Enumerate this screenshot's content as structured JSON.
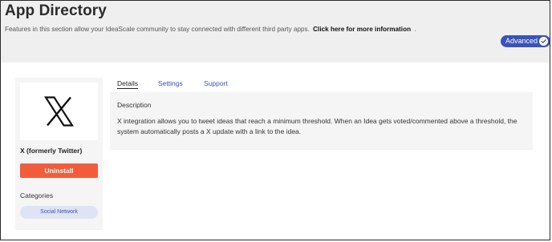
{
  "header": {
    "title": "App Directory",
    "intro_text": "Features in this section allow your IdeaScale community to stay connected with different third party apps.",
    "intro_link": "Click here for more information",
    "intro_suffix": ".",
    "advanced_label": "Advanced"
  },
  "app": {
    "name": "X (formerly Twitter)",
    "uninstall_label": "Uninstall",
    "categories_heading": "Categories",
    "categories": [
      "Social Network"
    ],
    "logo_icon": "x-logo-icon"
  },
  "tabs": [
    {
      "label": "Details",
      "active": true
    },
    {
      "label": "Settings",
      "active": false
    },
    {
      "label": "Support",
      "active": false
    }
  ],
  "details": {
    "heading": "Description",
    "body": "X integration allows you to tweet ideas that reach a minimum threshold. When an Idea gets voted/commented above a threshold, the system automatically posts a X update with a link to the idea."
  },
  "colors": {
    "accent": "#3a53b8",
    "danger": "#f25c3b",
    "header_bg": "#efefef",
    "panel_bg": "#f5f5f5",
    "pill_bg": "#dfe4f5"
  }
}
